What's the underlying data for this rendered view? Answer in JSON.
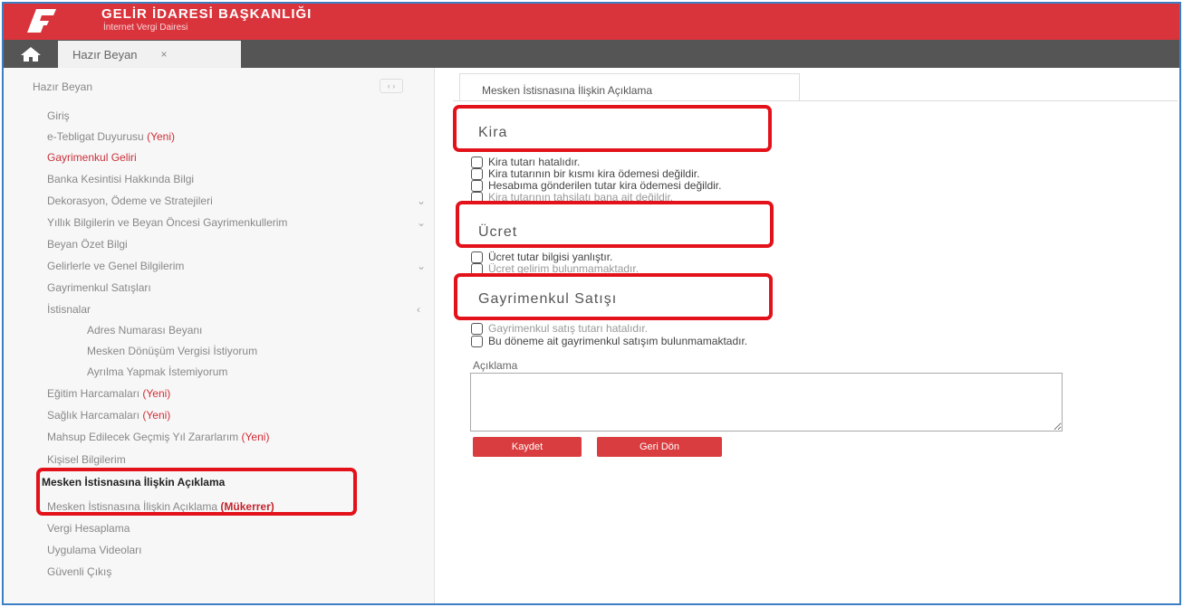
{
  "header": {
    "title": "GELİR İDARESİ BAŞKANLIĞI",
    "subtitle": "İnternet Vergi Dairesi",
    "brand_color": "#d9343c"
  },
  "tabbar": {
    "home_icon": "home-icon",
    "tab_label": "Hazır Beyan",
    "close_glyph": "×"
  },
  "sidebar": {
    "heading": "Hazır Beyan",
    "toggle": "‹ ›",
    "items": [
      {
        "label": "Giriş"
      },
      {
        "label": "e-Tebligat Duyurusu",
        "tag": "(Yeni)"
      },
      {
        "label": "Gayrimenkul Geliri"
      },
      {
        "label": "Banka Kesintisi Hakkında Bilgi"
      },
      {
        "label": "Dekorasyon, Ödeme ve Stratejileri",
        "chevron": "⌄"
      },
      {
        "label": "Yıllık Bilgilerin ve Beyan Öncesi Gayrimenkullerim",
        "chevron": "⌄"
      },
      {
        "label": "Beyan Özet Bilgi"
      },
      {
        "label": "Gelirlerle ve Genel Bilgilerim",
        "chevron": "⌄"
      },
      {
        "label": "Gayrimenkul Satışları"
      },
      {
        "label": "İstisnalar",
        "chevron": "‹"
      },
      {
        "label": "Adres Numarası Beyanı"
      },
      {
        "label": "Mesken Dönüşüm Vergisi İstiyorum"
      },
      {
        "label": "Ayrılma Yapmak İstemiyorum"
      },
      {
        "label": "Eğitim Harcamaları",
        "tag": "(Yeni)"
      },
      {
        "label": "Sağlık Harcamaları",
        "tag": "(Yeni)"
      },
      {
        "label": "Mahsup Edilecek Geçmiş Yıl Zararlarım",
        "tag": "(Yeni)"
      },
      {
        "label": "Kişisel Bilgilerim"
      },
      {
        "label": "Mesken İstisnasına İlişkin Açıklama"
      },
      {
        "label": "Mesken İstisnasına İlişkin Açıklama",
        "tag": "(Mükerrer)"
      },
      {
        "label": "Vergi Hesaplama"
      },
      {
        "label": "Uygulama Videoları"
      },
      {
        "label": "Güvenli Çıkış"
      }
    ]
  },
  "content": {
    "tab_label": "Mesken İstisnasına İlişkin Açıklama",
    "sections": [
      {
        "title": "Kira",
        "options": [
          "Kira tutarı hatalıdır.",
          "Kira tutarının bir kısmı kira ödemesi değildir.",
          "Hesabıma gönderilen tutar kira ödemesi değildir.",
          "Kira tutarının tahsilatı bana ait değildir."
        ]
      },
      {
        "title": "Ücret",
        "options": [
          "Ücret tutar bilgisi yanlıştır.",
          "Ücret gelirim bulunmamaktadır."
        ]
      },
      {
        "title": "Gayrimenkul Satışı",
        "options": [
          "Gayrimenkul satış tutarı hatalıdır.",
          "Bu döneme ait gayrimenkul satışım bulunmamaktadır."
        ]
      }
    ],
    "note_label": "Açıklama",
    "note_value": "",
    "save_label": "Kaydet",
    "back_label": "Geri Dön",
    "highlight_color": "#e3121a"
  }
}
